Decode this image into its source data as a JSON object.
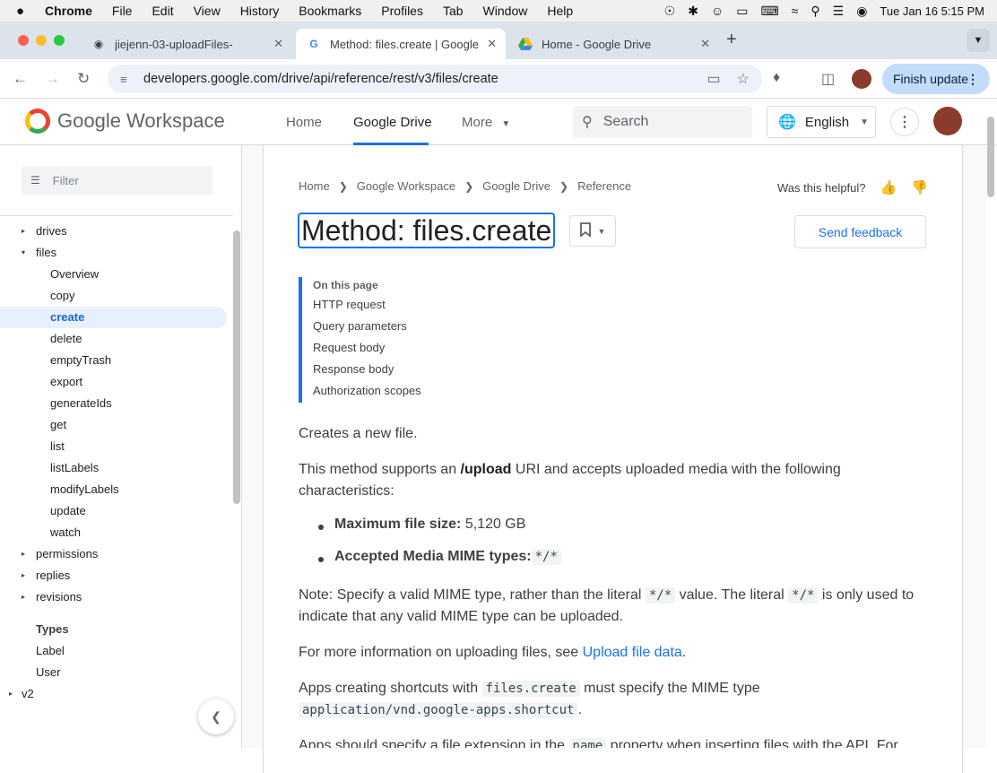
{
  "menubar": {
    "apple": "",
    "items": [
      "Chrome",
      "File",
      "Edit",
      "View",
      "History",
      "Bookmarks",
      "Profiles",
      "Tab",
      "Window",
      "Help"
    ],
    "clock": "Tue Jan 16  5:15 PM"
  },
  "tabs": [
    {
      "title": "jiejenn-03-uploadFiles-",
      "active": false
    },
    {
      "title": "Method: files.create  |  Google",
      "active": true
    },
    {
      "title": "Home - Google Drive",
      "active": false
    }
  ],
  "omnibox": {
    "url": "developers.google.com/drive/api/reference/rest/v3/files/create"
  },
  "finish_update": "Finish update",
  "site": {
    "logo_text": "Google Workspace",
    "nav": [
      "Home",
      "Google Drive",
      "More"
    ],
    "search_placeholder": "Search",
    "language": "English"
  },
  "sidebar": {
    "filter_placeholder": "Filter",
    "items": [
      {
        "label": "drives",
        "level": 1,
        "arrow": "▸"
      },
      {
        "label": "files",
        "level": 1,
        "arrow": "▾"
      },
      {
        "label": "Overview",
        "level": 2
      },
      {
        "label": "copy",
        "level": 2
      },
      {
        "label": "create",
        "level": 2,
        "active": true
      },
      {
        "label": "delete",
        "level": 2
      },
      {
        "label": "emptyTrash",
        "level": 2
      },
      {
        "label": "export",
        "level": 2
      },
      {
        "label": "generateIds",
        "level": 2
      },
      {
        "label": "get",
        "level": 2
      },
      {
        "label": "list",
        "level": 2
      },
      {
        "label": "listLabels",
        "level": 2
      },
      {
        "label": "modifyLabels",
        "level": 2
      },
      {
        "label": "update",
        "level": 2
      },
      {
        "label": "watch",
        "level": 2
      },
      {
        "label": "permissions",
        "level": 1,
        "arrow": "▸"
      },
      {
        "label": "replies",
        "level": 1,
        "arrow": "▸"
      },
      {
        "label": "revisions",
        "level": 1,
        "arrow": "▸"
      }
    ],
    "types_heading": "Types",
    "types": [
      "Label",
      "User"
    ],
    "v2": "v2"
  },
  "breadcrumb": [
    "Home",
    "Google Workspace",
    "Google Drive",
    "Reference"
  ],
  "helpful_text": "Was this helpful?",
  "page_title": "Method: files.create",
  "send_feedback": "Send feedback",
  "toc": {
    "heading": "On this page",
    "links": [
      "HTTP request",
      "Query parameters",
      "Request body",
      "Response body",
      "Authorization scopes"
    ]
  },
  "body": {
    "p1": "Creates a new file.",
    "p2_a": "This method supports an ",
    "p2_b": "/upload",
    "p2_c": " URI and accepts uploaded media with the following characteristics:",
    "b1_label": "Maximum file size:",
    "b1_value": " 5,120 GB",
    "b2_label": "Accepted Media MIME types:",
    "b2_code": "*/*",
    "note_a": "Note: Specify a valid MIME type, rather than the literal ",
    "note_code1": "*/*",
    "note_b": " value. The literal ",
    "note_code2": "*/*",
    "note_c": " is only used to indicate that any valid MIME type can be uploaded.",
    "more_a": "For more information on uploading files, see ",
    "more_link": "Upload file data",
    "more_b": ".",
    "short_a": "Apps creating shortcuts with ",
    "short_code1": "files.create",
    "short_b": " must specify the MIME type ",
    "short_code2": "application/vnd.google-apps.shortcut",
    "short_c": ".",
    "last_a": "Apps should specify a file extension in the ",
    "last_code": "name",
    "last_b": " property when inserting files with the API. For"
  }
}
